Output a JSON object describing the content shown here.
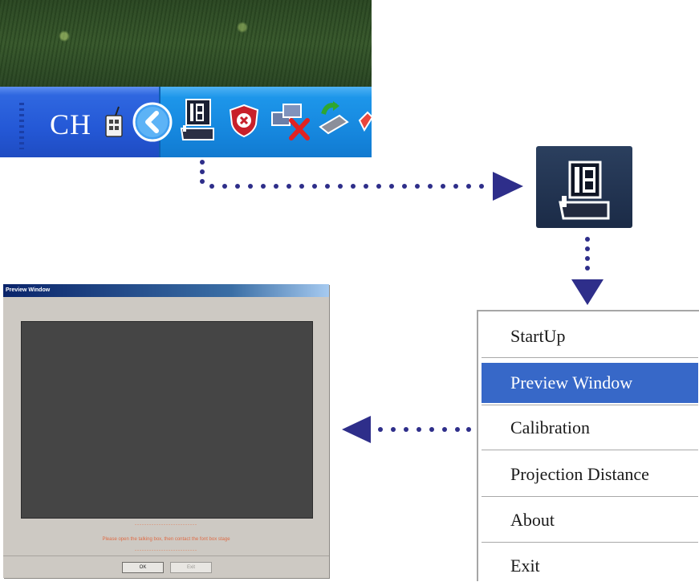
{
  "taskbar": {
    "language_indicator": "CH",
    "tray_icons": [
      "keyboard-icon",
      "show-hidden-icons-chevron-icon",
      "projector-app-icon",
      "security-alert-shield-icon",
      "network-disconnected-icon",
      "safely-remove-hardware-icon",
      "volume-icon"
    ]
  },
  "enlarged_icon": {
    "icon": "projector-app-icon"
  },
  "context_menu": {
    "items": [
      {
        "label": "StartUp"
      },
      {
        "label": "Preview Window"
      },
      {
        "label": "Calibration"
      },
      {
        "label": "Projection Distance"
      },
      {
        "label": "About"
      },
      {
        "label": "Exit"
      }
    ],
    "selected_index": 1,
    "selected_color": "#3768c8"
  },
  "preview_dialog": {
    "title": "Preview Window",
    "message_dashes": "--------------------------",
    "message": "Please open the talking box, then contact the font box stage",
    "ok_label": "OK",
    "cancel_label": "Exit"
  },
  "colors": {
    "taskbar_blue": "#2458d6",
    "tray_blue": "#1585dc",
    "arrow_navy": "#2e2e8a",
    "message_orange": "#de6b45"
  }
}
